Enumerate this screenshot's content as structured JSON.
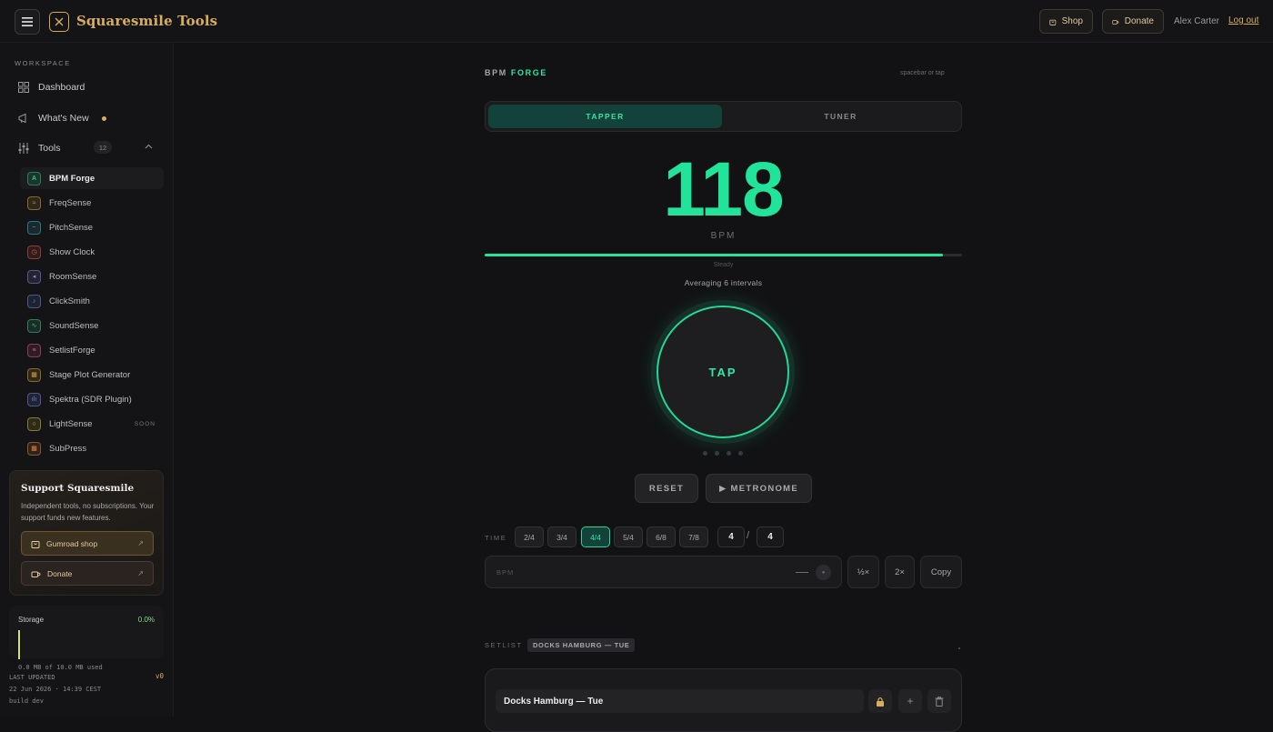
{
  "header": {
    "brand": "Squaresmile Tools",
    "shop_label": "Shop",
    "donate_label": "Donate",
    "user_name": "Alex Carter",
    "logout_label": "Log out"
  },
  "sidebar": {
    "section_label": "WORKSPACE",
    "nav": [
      {
        "label": "Dashboard",
        "icon": "grid-icon"
      },
      {
        "label": "What's New",
        "icon": "megaphone-icon"
      },
      {
        "label": "Tools",
        "icon": "sliders-icon",
        "count": "12"
      }
    ],
    "tools": [
      {
        "label": "BPM Forge",
        "color": "#22c98a",
        "glyph": "A",
        "active": true
      },
      {
        "label": "FreqSense",
        "color": "#d7a23a",
        "glyph": "≈"
      },
      {
        "label": "PitchSense",
        "color": "#3fb6c9",
        "glyph": "~"
      },
      {
        "label": "Show Clock",
        "color": "#e05a4a",
        "glyph": "◷"
      },
      {
        "label": "RoomSense",
        "color": "#8a84e0",
        "glyph": "◂"
      },
      {
        "label": "ClickSmith",
        "color": "#6a8ae0",
        "glyph": "♪"
      },
      {
        "label": "SoundSense",
        "color": "#3fc98a",
        "glyph": "∿"
      },
      {
        "label": "SetlistForge",
        "color": "#e05a8a",
        "glyph": "≡"
      },
      {
        "label": "Stage Plot Generator",
        "color": "#d7a23a",
        "glyph": "▦"
      },
      {
        "label": "Spektra (SDR Plugin)",
        "color": "#7a84e0",
        "glyph": "ılı"
      },
      {
        "label": "LightSense",
        "color": "#d7c23a",
        "glyph": "○",
        "badge": "SOON"
      },
      {
        "label": "SubPress",
        "color": "#e0803a",
        "glyph": "▩"
      }
    ],
    "support": {
      "title": "Support Squaresmile",
      "text": "Independent tools, no subscriptions. Your support funds new features.",
      "gumroad_label": "Gumroad shop",
      "donate_label": "Donate"
    },
    "storage": {
      "label": "Storage",
      "percent": "0.0%",
      "used_text": "0.0 MB of 10.0 MB used"
    },
    "footer": {
      "updated_label": "LAST UPDATED",
      "updated_value": "22 Jun 2026 · 14:39 CEST",
      "build": "build dev",
      "version": "v0"
    }
  },
  "main": {
    "title_prefix": "BPM",
    "title_accent": "FORGE",
    "hint": "spacebar or tap",
    "tabs": [
      "TAPPER",
      "TUNER"
    ],
    "bpm_value": "118",
    "bpm_unit": "BPM",
    "stability_label": "Steady",
    "stability_fraction": 0.96,
    "averaging_text": "Averaging 6 intervals",
    "tap_label": "TAP",
    "reset_label": "RESET",
    "metronome_label": "▶ METRONOME",
    "time_label": "TIME",
    "time_signatures": [
      "2/4",
      "3/4",
      "4/4",
      "5/4",
      "6/8",
      "7/8"
    ],
    "active_time_signature": "4/4",
    "numerator": "4",
    "denominator": "4",
    "bpm_input_placeholder": "BPM",
    "half_label": "½×",
    "double_label": "2×",
    "copy_label": "Copy",
    "setlist_label": "SETLIST",
    "setlist_tag": "DOCKS HAMBURG — TUE",
    "setlist_name": "Docks Hamburg — Tue"
  },
  "colors": {
    "accent_green": "#22e39a",
    "brand_gold": "#d7ad5e"
  }
}
